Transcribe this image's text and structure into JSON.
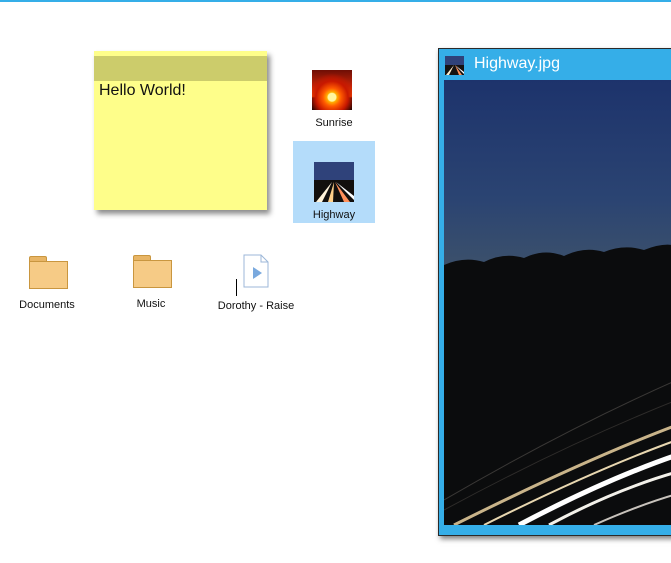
{
  "sticky_note": {
    "text": "Hello World!"
  },
  "desktop_icons": [
    {
      "label": "Sunrise",
      "icon": "sunrise-image-thumbnail"
    },
    {
      "label": "Highway",
      "icon": "highway-image-thumbnail",
      "selected": true
    },
    {
      "label": "Documents",
      "icon": "folder-icon"
    },
    {
      "label": "Music",
      "icon": "folder-icon"
    },
    {
      "label": "Dorothy - Raise",
      "icon": "media-file-icon"
    }
  ],
  "image_window": {
    "title": "Highway.jpg",
    "icon": "highway-image-icon"
  },
  "colors": {
    "accent": "#35aee8",
    "selection": "#b4dcfa",
    "sticky_note": "#fefe8a",
    "sticky_note_bar": "#cccc6b",
    "folder": "#f6cb86"
  }
}
